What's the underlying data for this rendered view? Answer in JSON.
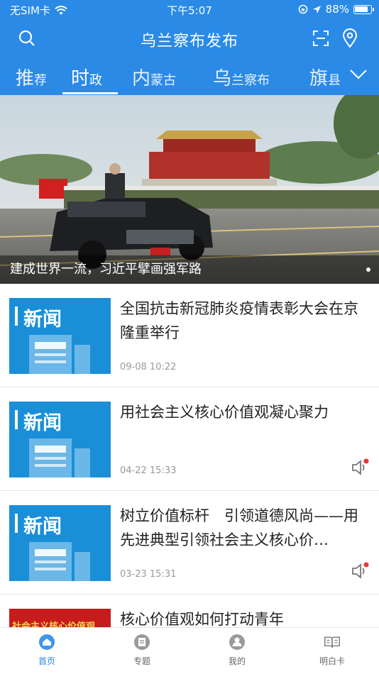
{
  "status_bar": {
    "carrier": "无SIM卡",
    "time": "下午5:07",
    "battery": "88%"
  },
  "header": {
    "title": "乌兰察布发布",
    "icons": [
      "search-icon",
      "scan-icon",
      "location-pin-icon"
    ]
  },
  "tabs": [
    {
      "big": "推",
      "small": "荐"
    },
    {
      "big": "时",
      "small": "政"
    },
    {
      "big": "内",
      "small": "蒙古"
    },
    {
      "big": "乌",
      "small": "兰察布"
    },
    {
      "big": "旗",
      "small": "县"
    }
  ],
  "active_tab": "时政",
  "banner": {
    "caption": "建成世界一流，习近平擘画强军路"
  },
  "news": [
    {
      "thumb_label": "新闻",
      "title": "全国抗击新冠肺炎疫情表彰大会在京隆重举行",
      "date": "09-08 10:22",
      "audio": false
    },
    {
      "thumb_label": "新闻",
      "title": "用社会主义核心价值观凝心聚力",
      "date": "04-22 15:33",
      "audio": true
    },
    {
      "thumb_label": "新闻",
      "title": "树立价值标杆　引领道德风尚——用先进典型引领社会主义核心价…",
      "date": "03-23 15:31",
      "audio": true
    },
    {
      "thumb_label": "社会主义核心价值观",
      "title": "核心价值观如何打动青年",
      "date": "",
      "audio": false
    }
  ],
  "tabbar": [
    {
      "label": "首页",
      "icon": "home-icon",
      "active": true
    },
    {
      "label": "专题",
      "icon": "topic-icon",
      "active": false
    },
    {
      "label": "我的",
      "icon": "user-icon",
      "active": false
    },
    {
      "label": "明白卡",
      "icon": "book-icon",
      "active": false
    }
  ],
  "colors": {
    "brand": "#2a8ae6",
    "thumb": "#1a8fd8",
    "accent_dot": "#e53935"
  }
}
